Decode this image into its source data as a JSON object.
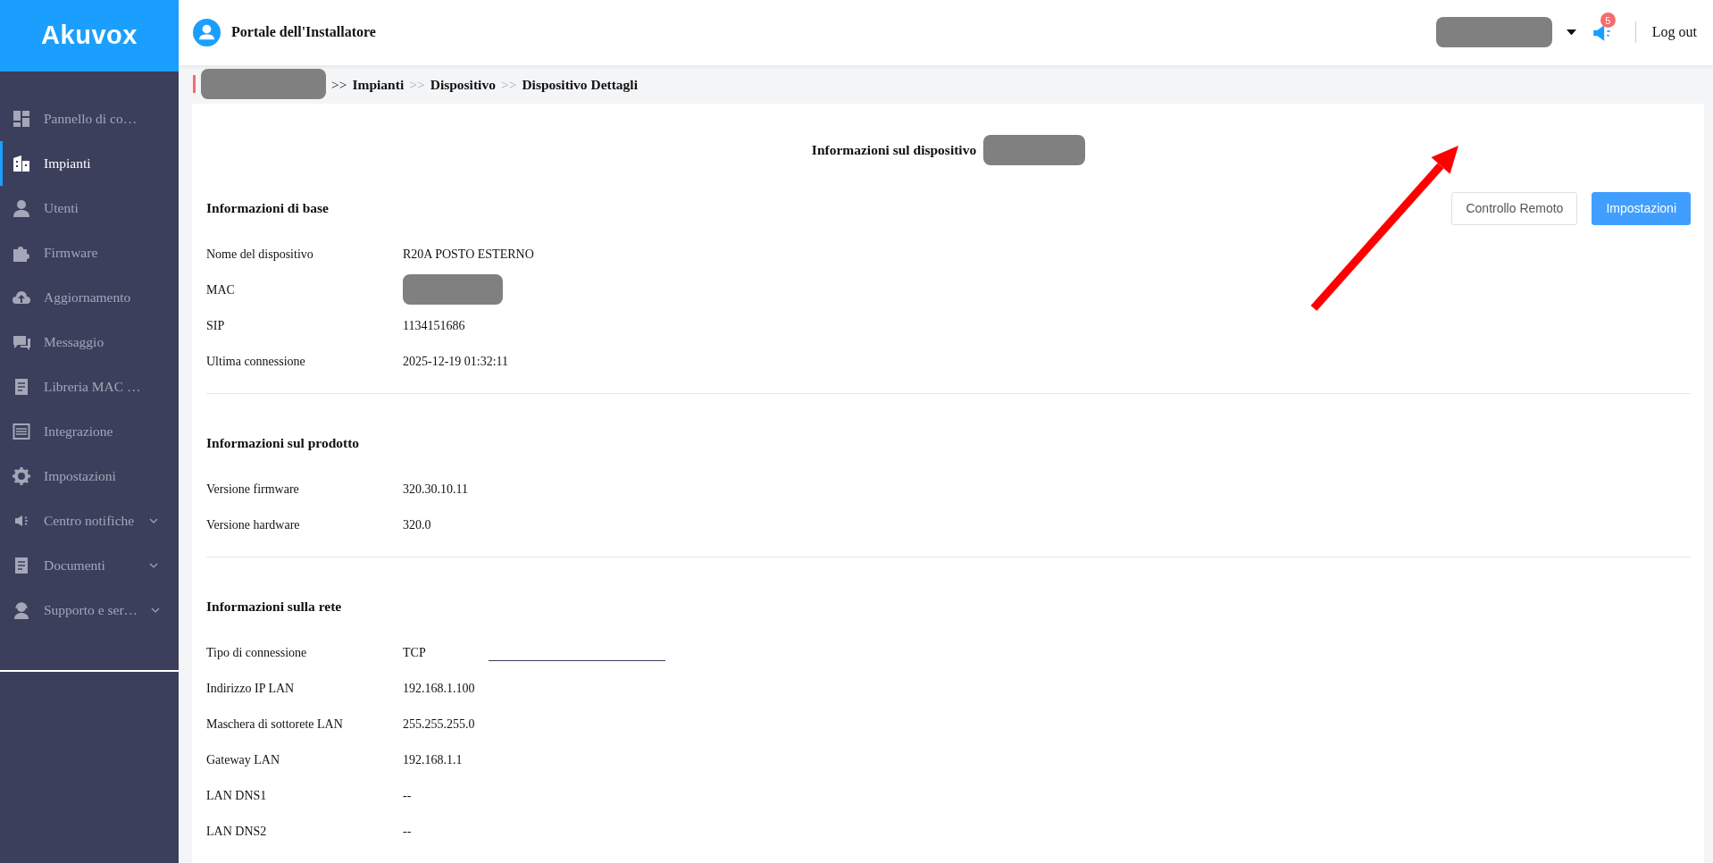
{
  "header": {
    "logo": "Akuvox",
    "portal_title": "Portale dell'Installatore",
    "notification_count": "5",
    "logout": "Log out"
  },
  "sidebar": {
    "items": [
      {
        "label": "Pannello di co…",
        "selected": false,
        "expandable": false
      },
      {
        "label": "Impianti",
        "selected": true,
        "expandable": false
      },
      {
        "label": "Utenti",
        "selected": false,
        "expandable": false
      },
      {
        "label": "Firmware",
        "selected": false,
        "expandable": false
      },
      {
        "label": "Aggiornamento",
        "selected": false,
        "expandable": false
      },
      {
        "label": "Messaggio",
        "selected": false,
        "expandable": false
      },
      {
        "label": "Libreria MAC …",
        "selected": false,
        "expandable": false
      },
      {
        "label": "Integrazione",
        "selected": false,
        "expandable": false
      },
      {
        "label": "Impostazioni",
        "selected": false,
        "expandable": false
      },
      {
        "label": "Centro notifiche",
        "selected": false,
        "expandable": true
      },
      {
        "label": "Documenti",
        "selected": false,
        "expandable": true
      },
      {
        "label": "Supporto e ser…",
        "selected": false,
        "expandable": true
      }
    ]
  },
  "breadcrumb": {
    "items": [
      {
        "separator": ">>",
        "separator_muted": false,
        "label": "Impianti"
      },
      {
        "separator": ">>",
        "separator_muted": true,
        "label": "Dispositivo"
      },
      {
        "separator": ">>",
        "separator_muted": true,
        "label": "Dispositivo Dettagli"
      }
    ]
  },
  "device_title": "Informazioni sul dispositivo",
  "sections": [
    {
      "title": "Informazioni di base",
      "actions": [
        {
          "label": "Controllo Remoto",
          "kind": "outline"
        },
        {
          "label": "Impostazioni",
          "kind": "primary"
        }
      ],
      "fields": [
        {
          "label": "Nome del dispositivo",
          "value": "R20A POSTO ESTERNO",
          "redacted": false
        },
        {
          "label": "MAC",
          "redacted": true
        },
        {
          "label": "SIP",
          "value": "1134151686",
          "redacted": false
        },
        {
          "label": "Ultima connessione",
          "value": "2025-12-19 01:32:11",
          "redacted": false
        }
      ]
    },
    {
      "title": "Informazioni sul prodotto",
      "fields": [
        {
          "label": "Versione firmware",
          "value": "320.30.10.11",
          "redacted": false
        },
        {
          "label": "Versione hardware",
          "value": "320.0",
          "redacted": false
        }
      ]
    },
    {
      "title": "Informazioni sulla rete",
      "fields": [
        {
          "label": "Tipo di connessione",
          "value": "TCP",
          "redacted": false
        },
        {
          "label": "Indirizzo IP LAN",
          "value": "192.168.1.100",
          "redacted": false
        },
        {
          "label": "Maschera di sottorete LAN",
          "value": "255.255.255.0",
          "redacted": false
        },
        {
          "label": "Gateway LAN",
          "value": "192.168.1.1",
          "redacted": false
        },
        {
          "label": "LAN DNS1",
          "value": "--",
          "redacted": false
        },
        {
          "label": "LAN DNS2",
          "value": "--",
          "redacted": false
        }
      ]
    }
  ]
}
